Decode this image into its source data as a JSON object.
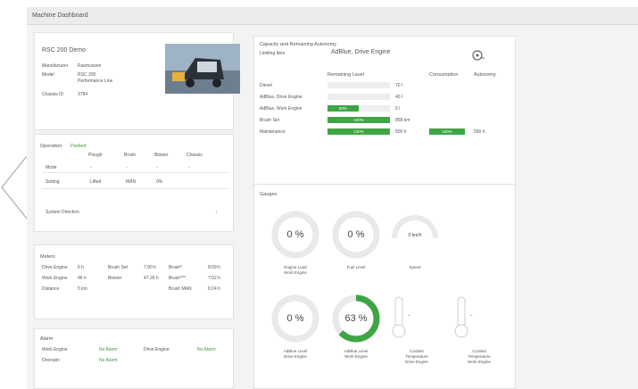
{
  "window": {
    "title": "Machine Dashboard"
  },
  "machine": {
    "name": "RSC 200 Demo",
    "fields": [
      {
        "label": "Manufacturer",
        "value": "Rasmussen"
      },
      {
        "label": "Model",
        "value": "RSC 200\nPerformance Line"
      },
      {
        "label": "Chassis ID",
        "value": "3784"
      }
    ]
  },
  "operation": {
    "label": "Operation:",
    "status": "Parked",
    "columns": [
      "Plough",
      "Brush",
      "Blower",
      "Chassis"
    ],
    "rows": [
      {
        "label": "Mode",
        "values": [
          "-",
          "-",
          "-",
          "-"
        ]
      },
      {
        "label": "Setting",
        "values": [
          "Lifted",
          "MAN",
          "0%",
          ""
        ]
      }
    ],
    "system_direction_label": "System Direction",
    "system_direction_value": "↑"
  },
  "meters": {
    "title": "Meters",
    "rows": [
      [
        "Drive Engine",
        "6 h",
        "Brush Set",
        "7:00 h",
        "Brush*",
        "8:09 h"
      ],
      [
        "Work Engine",
        "46 h",
        "Blower",
        "47.26 h",
        "Brush***",
        "7:02 h"
      ],
      [
        "Distance",
        "5 km",
        "",
        "",
        "Brush MAN",
        "6:24 h"
      ]
    ]
  },
  "alarm": {
    "title": "Alarm",
    "rows": [
      [
        "Work Engine",
        "No Alarm",
        "Drive Engine",
        "No Alarm"
      ],
      [
        "Overspin",
        "No Alarm",
        "",
        ""
      ]
    ]
  },
  "capacity": {
    "title": "Capacity and Remaining Autonomy",
    "limiting_label": "Limiting Item",
    "limiting_value": "AdBlue, Drive Engine",
    "col_remaining": "Remaining Level",
    "col_consumption": "Consumption",
    "col_autonomy": "Autonomy",
    "rows": [
      {
        "label": "Diesel",
        "level": 0,
        "bar_text": "",
        "amount": "70 l",
        "consumption": "",
        "cons_level": 0,
        "cons_text": "",
        "autonomy": ""
      },
      {
        "label": "AdBlue, Drive Engine",
        "level": 0,
        "bar_text": "",
        "amount": "40 l",
        "consumption": "",
        "cons_level": 0,
        "cons_text": "",
        "autonomy": ""
      },
      {
        "label": "AdBlue, Work Engine",
        "level": 0.5,
        "bar_text": "50%",
        "amount": "5 l",
        "consumption": "",
        "cons_level": 0,
        "cons_text": "",
        "autonomy": ""
      },
      {
        "label": "Brush Set",
        "level": 1,
        "bar_text": "100%",
        "amount": "858 km",
        "consumption": "",
        "cons_level": 0,
        "cons_text": "",
        "autonomy": ""
      },
      {
        "label": "Maintenance",
        "level": 1,
        "bar_text": "100%",
        "amount": "500 h",
        "consumption": "",
        "cons_level": 1,
        "cons_text": "100%",
        "autonomy": "500 h"
      }
    ]
  },
  "gauges": {
    "title": "Gauges",
    "items": [
      {
        "label": "Engine Load\nWork Engine",
        "value": "0 %",
        "fraction": 0,
        "kind": "ring"
      },
      {
        "label": "Fuel Level",
        "value": "0 %",
        "fraction": 0,
        "kind": "ring"
      },
      {
        "label": "Speed",
        "value": "0 km/h",
        "fraction": 0,
        "kind": "arc"
      },
      {
        "label": "AdBlue Level\nDrive Engine",
        "value": "0 %",
        "fraction": 0,
        "kind": "ring"
      },
      {
        "label": "AdBlue Level\nWork Engine",
        "value": "63 %",
        "fraction": 0.63,
        "kind": "ring"
      },
      {
        "label": "Coolant\nTemperature\nDrive Engine",
        "value": "-",
        "fraction": 0,
        "kind": "thermo"
      },
      {
        "label": "Coolant\nTemperature\nWork Engine",
        "value": "-",
        "fraction": 0,
        "kind": "thermo"
      }
    ]
  },
  "colors": {
    "accent": "#3fa544",
    "track": "#e9e9e9"
  }
}
